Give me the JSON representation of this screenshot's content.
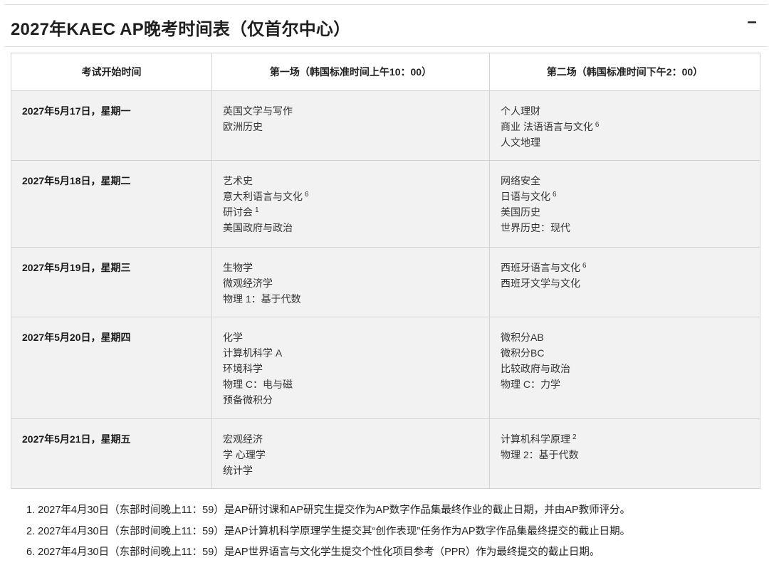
{
  "panel": {
    "title": "2027年KAEC AP晚考时间表（仅首尔中心）",
    "toggle_label": "–"
  },
  "table": {
    "headers": [
      "考试开始时间",
      "第一场（韩国标准时间上午10：00）",
      "第二场（韩国标准时间下午2：00）"
    ],
    "rows": [
      {
        "date": "2027年5月17日，星期一",
        "session1": [
          {
            "name": "英国文学与写作"
          },
          {
            "name": "欧洲历史"
          }
        ],
        "session2": [
          {
            "name": "个人理财"
          },
          {
            "name": "商业 法语语言与文化",
            "note": "6"
          },
          {
            "name": "人文地理"
          }
        ]
      },
      {
        "date": "2027年5月18日，星期二",
        "session1": [
          {
            "name": "艺术史"
          },
          {
            "name": "意大利语言与文化",
            "note": "6"
          },
          {
            "name": "研讨会",
            "note": "1"
          },
          {
            "name": "美国政府与政治"
          }
        ],
        "session2": [
          {
            "name": "网络安全"
          },
          {
            "name": "日语与文化",
            "note": "6"
          },
          {
            "name": "美国历史"
          },
          {
            "name": "世界历史：现代"
          }
        ]
      },
      {
        "date": "2027年5月19日，星期三",
        "session1": [
          {
            "name": "生物学"
          },
          {
            "name": "微观经济学"
          },
          {
            "name": "物理 1：基于代数"
          }
        ],
        "session2": [
          {
            "name": "西班牙语言与文化",
            "note": "6"
          },
          {
            "name": "西班牙文学与文化"
          }
        ]
      },
      {
        "date": "2027年5月20日，星期四",
        "session1": [
          {
            "name": "化学"
          },
          {
            "name": "计算机科学 A"
          },
          {
            "name": "环境科学"
          },
          {
            "name": "物理 C：电与磁"
          },
          {
            "name": "预备微积分"
          }
        ],
        "session2": [
          {
            "name": "微积分AB"
          },
          {
            "name": "微积分BC"
          },
          {
            "name": "比较政府与政治"
          },
          {
            "name": "物理 C：力学"
          }
        ]
      },
      {
        "date": "2027年5月21日，星期五",
        "session1": [
          {
            "name": "宏观经济"
          },
          {
            "name": "学 心理学"
          },
          {
            "name": "统计学"
          }
        ],
        "session2": [
          {
            "name": "计算机科学原理",
            "note": "2"
          },
          {
            "name": "物理 2：基于代数"
          }
        ]
      }
    ]
  },
  "footnotes": [
    {
      "num": "1.",
      "text": "2027年4月30日（东部时间晚上11：59）是AP研讨课和AP研究生提交作为AP数字作品集最终作业的截止日期，并由AP教师评分。"
    },
    {
      "num": "2.",
      "text": "2027年4月30日（东部时间晚上11：59）是AP计算机科学原理学生提交其“创作表现”任务作为AP数字作品集最终提交的截止日期。"
    },
    {
      "num": "6.",
      "text": "2027年4月30日（东部时间晚上11：59）是AP世界语言与文化学生提交个性化项目参考（PPR）作为最终提交的截止日期。"
    }
  ]
}
